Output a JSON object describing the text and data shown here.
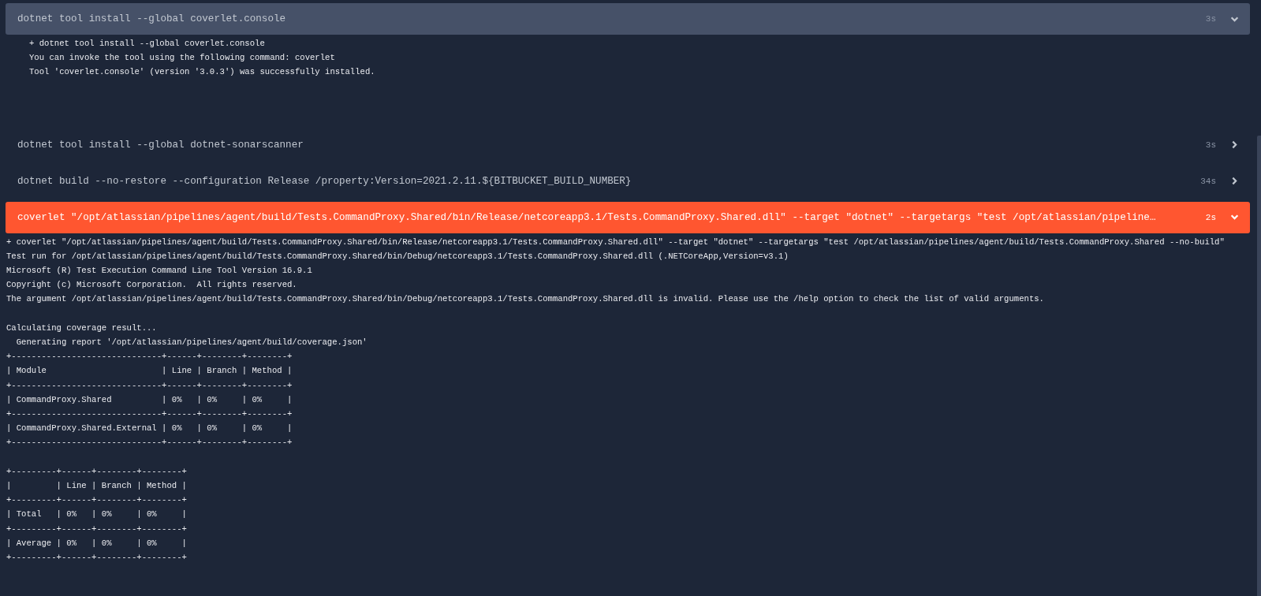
{
  "steps": [
    {
      "command": "dotnet tool install --global coverlet.console",
      "duration": "3s",
      "expanded": true,
      "failed": false,
      "log": [
        [
          "+ dotnet tool install --global coverlet.console",
          "You can invoke the tool using the following command: coverlet",
          "Tool 'coverlet.console' (version '3.0.3') was successfully installed."
        ]
      ]
    },
    {
      "command": "dotnet tool install --global dotnet-sonarscanner",
      "duration": "3s",
      "expanded": false,
      "failed": false
    },
    {
      "command": "dotnet build --no-restore --configuration Release /property:Version=2021.2.11.${BITBUCKET_BUILD_NUMBER}",
      "duration": "34s",
      "expanded": false,
      "failed": false
    },
    {
      "command": "coverlet \"/opt/atlassian/pipelines/agent/build/Tests.CommandProxy.Shared/bin/Release/netcoreapp3.1/Tests.CommandProxy.Shared.dll\" --target \"dotnet\" --targetargs \"test /opt/atlassian/pipeline…",
      "duration": "2s",
      "expanded": true,
      "failed": true,
      "log": [
        [
          "+ coverlet \"/opt/atlassian/pipelines/agent/build/Tests.CommandProxy.Shared/bin/Release/netcoreapp3.1/Tests.CommandProxy.Shared.dll\" --target \"dotnet\" --targetargs \"test /opt/atlassian/pipelines/agent/build/Tests.CommandProxy.Shared --no-build\"",
          "Test run for /opt/atlassian/pipelines/agent/build/Tests.CommandProxy.Shared/bin/Debug/netcoreapp3.1/Tests.CommandProxy.Shared.dll (.NETCoreApp,Version=v3.1)",
          "Microsoft (R) Test Execution Command Line Tool Version 16.9.1",
          "Copyright (c) Microsoft Corporation.  All rights reserved.",
          "The argument /opt/atlassian/pipelines/agent/build/Tests.CommandProxy.Shared/bin/Debug/netcoreapp3.1/Tests.CommandProxy.Shared.dll is invalid. Please use the /help option to check the list of valid arguments."
        ],
        [
          "Calculating coverage result...",
          "  Generating report '/opt/atlassian/pipelines/agent/build/coverage.json'",
          "+------------------------------+------+--------+--------+",
          "| Module                       | Line | Branch | Method |",
          "+------------------------------+------+--------+--------+",
          "| CommandProxy.Shared          | 0%   | 0%     | 0%     |",
          "+------------------------------+------+--------+--------+",
          "| CommandProxy.Shared.External | 0%   | 0%     | 0%     |",
          "+------------------------------+------+--------+--------+"
        ],
        [
          "+---------+------+--------+--------+",
          "|         | Line | Branch | Method |",
          "+---------+------+--------+--------+",
          "| Total   | 0%   | 0%     | 0%     |",
          "+---------+------+--------+--------+",
          "| Average | 0%   | 0%     | 0%     |",
          "+---------+------+--------+--------+"
        ]
      ]
    }
  ]
}
